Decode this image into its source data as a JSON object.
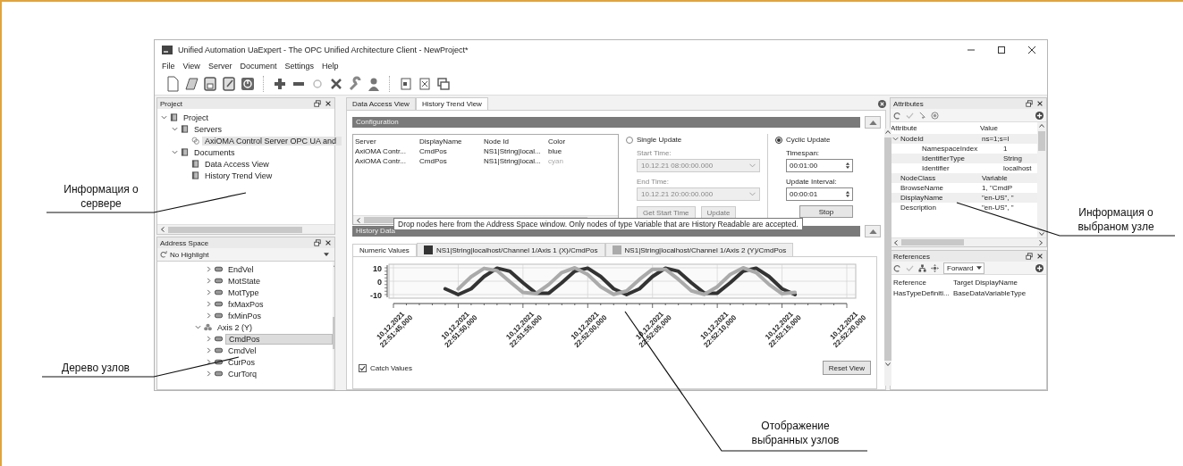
{
  "window": {
    "title": "Unified Automation UaExpert - The OPC Unified Architecture Client - NewProject*"
  },
  "menu": [
    "File",
    "View",
    "Server",
    "Document",
    "Settings",
    "Help"
  ],
  "project_panel": {
    "title": "Project",
    "tree": [
      {
        "label": "Project",
        "kind": "folder",
        "expanded": true,
        "selected": false,
        "children": [
          {
            "label": "Servers",
            "kind": "folder",
            "expanded": true,
            "selected": false,
            "children": [
              {
                "label": "AxiOMA Control Server OPC UA and",
                "kind": "server",
                "selected": true
              }
            ]
          },
          {
            "label": "Documents",
            "kind": "folder",
            "expanded": true,
            "selected": false,
            "children": [
              {
                "label": "Data Access View",
                "kind": "folder",
                "selected": false
              },
              {
                "label": "History Trend View",
                "kind": "folder",
                "selected": false
              }
            ]
          }
        ]
      }
    ]
  },
  "address_space": {
    "title": "Address Space",
    "filter": "No Highlight",
    "tree": [
      {
        "children": [
          {
            "label": "EndVel",
            "kind": "variable",
            "expanded": false,
            "selected": false
          },
          {
            "label": "MotState",
            "kind": "variable",
            "expanded": false,
            "selected": false
          },
          {
            "label": "MotType",
            "kind": "variable",
            "expanded": false,
            "selected": false
          },
          {
            "label": "fxMaxPos",
            "kind": "variable",
            "expanded": false,
            "selected": false
          },
          {
            "label": "fxMinPos",
            "kind": "variable",
            "expanded": false,
            "selected": false
          }
        ]
      },
      {
        "label": "Axis 2 (Y)",
        "kind": "object",
        "expanded": true,
        "selected": false,
        "children": [
          {
            "label": "CmdPos",
            "kind": "variable",
            "expanded": false,
            "selected": true
          },
          {
            "label": "CmdVel",
            "kind": "variable",
            "expanded": false,
            "selected": false
          },
          {
            "label": "CurPos",
            "kind": "variable",
            "expanded": false,
            "selected": false
          },
          {
            "label": "CurTorq",
            "kind": "variable",
            "expanded": false,
            "selected": false
          }
        ]
      }
    ]
  },
  "tabs": [
    {
      "label": "Data Access View",
      "selected": false
    },
    {
      "label": "History Trend View",
      "selected": true
    }
  ],
  "configuration": {
    "title": "Configuration",
    "columns": [
      "Server",
      "DisplayName",
      "Node Id",
      "Color"
    ],
    "rows": [
      {
        "server": "AxiOMA Contr...",
        "display_name": "CmdPos",
        "node_id": "NS1|String|local...",
        "color_name": "blue",
        "dimmed": false
      },
      {
        "server": "AxiOMA Contr...",
        "display_name": "CmdPos",
        "node_id": "NS1|String|local...",
        "color_name": "cyan",
        "dimmed": true
      }
    ]
  },
  "single_update": {
    "label": "Single Update",
    "selected": false,
    "start_label": "Start Time:",
    "start_value": "10.12.21 08:00:00.000",
    "end_label": "End Time:",
    "end_value": "10.12.21 20:00:00.000",
    "disabled": true,
    "buttons": [
      {
        "label": "Get Start Time",
        "disabled": true
      },
      {
        "label": "Update",
        "disabled": true
      }
    ]
  },
  "cyclic_update": {
    "label": "Cyclic Update",
    "selected": true,
    "timespan_label": "Timespan:",
    "timespan": "00:01:00",
    "interval_label": "Update Interval:",
    "interval": "00:00:01",
    "button": {
      "label": "Stop",
      "disabled": false
    }
  },
  "tooltip": "Drop nodes here from the Address Space window. Only nodes of type Variable that are History Readable are accepted.",
  "history": {
    "title": "History Data",
    "numeric_tab": {
      "label": "Numeric Values",
      "selected": true
    },
    "series_tabs": [
      {
        "selected": false
      },
      {
        "selected": false
      }
    ],
    "chart_data": {
      "type": "line",
      "categories": [
        "10,12,2021 22:51:45,000",
        null,
        null,
        null,
        null,
        "10,12,2021 22:51:50,000",
        null,
        null,
        null,
        null,
        "10,12,2021 22:51:55,000",
        null,
        null,
        null,
        null,
        "10,12,2021 22:52:00,000",
        null,
        null,
        null,
        null,
        "10,12,2021 22:52:05,000",
        null,
        null,
        null,
        null,
        "10,12,2021 22:52:10,000",
        null,
        null,
        null,
        null,
        "10,12,2021 22:52:15,000",
        null,
        null,
        null,
        null,
        "10,12,2021 22:52:20,000"
      ],
      "series": [
        {
          "name": "NS1|String|localhost/Channel 1/Axis 1 (X)/CmdPos",
          "color": "#333333",
          "values": [
            null,
            null,
            null,
            null,
            -5.7,
            -10,
            -5.7,
            3.5,
            9.7,
            7.4,
            -1.2,
            -8.9,
            -8.9,
            -1.2,
            7.5,
            9.7,
            3.5,
            -5.7,
            -10,
            -5.7,
            3.5,
            9.7,
            7.4,
            -1.2,
            -8.9,
            -8.9,
            -1.2,
            7.5,
            9.7,
            3.5,
            -5.7,
            -10,
            null,
            null,
            null,
            null
          ]
        },
        {
          "name": "NS1|String|localhost/Channel 1/Axis 2 (Y)/CmdPos",
          "color": "#aaaaaa",
          "values": [
            null,
            null,
            null,
            null,
            null,
            -5.8,
            3.3,
            9.6,
            7.9,
            -0.5,
            -8.4,
            -9.3,
            -2.4,
            6.5,
            10,
            5,
            -4.2,
            -9.8,
            -7.3,
            1.4,
            8.9,
            8.9,
            1.4,
            -7.2,
            -9.8,
            -4.2,
            5,
            10,
            6.5,
            -2.4,
            -9.3,
            -8.4,
            null,
            null,
            null,
            null
          ]
        }
      ],
      "ylim": [
        -10,
        10
      ],
      "yticks": [
        10,
        0,
        -10
      ],
      "grid": true
    },
    "catch_values": {
      "label": "Catch Values",
      "checked": true
    },
    "reset_button": "Reset View"
  },
  "attributes": {
    "title": "Attributes",
    "columns": [
      "Attribute",
      "Value"
    ],
    "rows": [
      {
        "name": "NodeId",
        "value": "ns=1;s=l",
        "expanded": true,
        "children": [
          {
            "name": "NamespaceIndex",
            "value": "1"
          },
          {
            "name": "IdentifierType",
            "value": "String"
          },
          {
            "name": "Identifier",
            "value": "localhost"
          }
        ]
      },
      {
        "name": "NodeClass",
        "value": "Variable"
      },
      {
        "name": "BrowseName",
        "value": "1, \"CmdP"
      },
      {
        "name": "DisplayName",
        "value": "\"en-US\", \""
      },
      {
        "name": "Description",
        "value": "\"en-US\", \""
      }
    ]
  },
  "references": {
    "title": "References",
    "direction": "Forward",
    "columns": [
      "Reference",
      "Target DisplayName"
    ],
    "rows": [
      [
        "HasTypeDefiniti...",
        "BaseDataVariableType"
      ]
    ]
  },
  "callouts": [
    {
      "text": "Информация о сервере"
    },
    {
      "text": "Информация о выбраном узле"
    },
    {
      "text": "Дерево узлов"
    },
    {
      "text": "Отображение выбранных узлов"
    }
  ]
}
